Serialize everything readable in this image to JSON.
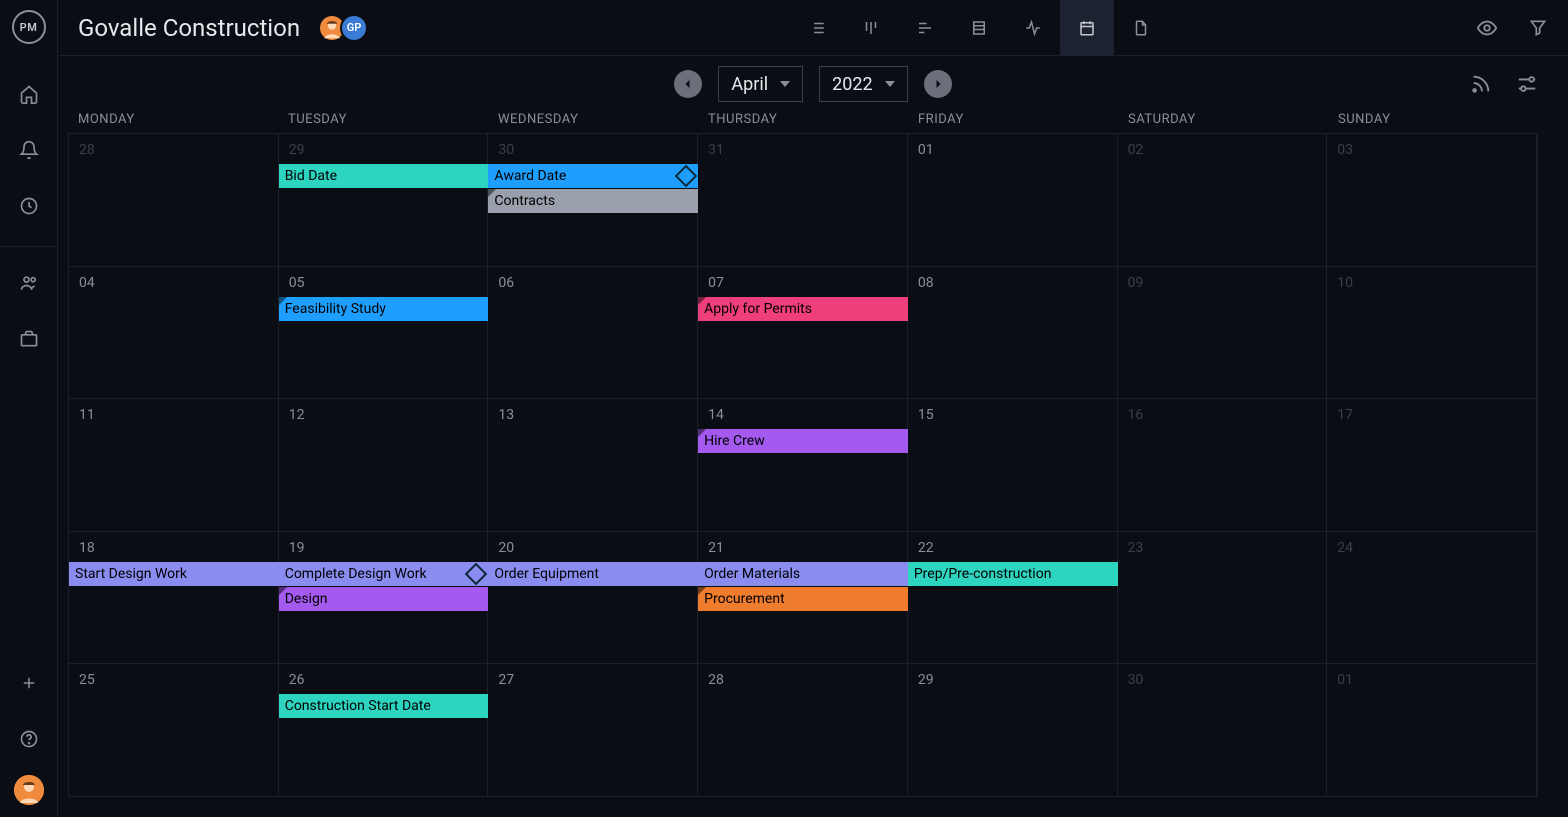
{
  "project": {
    "title": "Govalle Construction"
  },
  "members": [
    {
      "initials": "",
      "bg": "#f08a3c",
      "avatar": true
    },
    {
      "initials": "GP",
      "bg": "#3a7bd5",
      "avatar": false
    }
  ],
  "calendar": {
    "month": "April",
    "year": "2022",
    "dow": [
      "MONDAY",
      "TUESDAY",
      "WEDNESDAY",
      "THURSDAY",
      "FRIDAY",
      "SATURDAY",
      "SUNDAY"
    ],
    "weeks": [
      {
        "days": [
          {
            "n": "28",
            "off": true
          },
          {
            "n": "29",
            "off": true
          },
          {
            "n": "30",
            "off": true
          },
          {
            "n": "31",
            "off": true
          },
          {
            "n": "01",
            "off": false
          },
          {
            "n": "02",
            "off": true
          },
          {
            "n": "03",
            "off": true
          }
        ],
        "events": [
          {
            "label": "Bid Date",
            "startCol": 1,
            "span": 1,
            "row": 0,
            "color": "#2dd4bf",
            "light": false,
            "fold": false,
            "diamond": false
          },
          {
            "label": "Award Date",
            "startCol": 2,
            "span": 1,
            "row": 0,
            "color": "#1e9fff",
            "light": false,
            "fold": false,
            "diamond": true
          },
          {
            "label": "Contracts",
            "startCol": 2,
            "span": 1,
            "row": 1,
            "color": "#9aa0ab",
            "light": false,
            "fold": true,
            "diamond": false
          }
        ]
      },
      {
        "days": [
          {
            "n": "04",
            "off": false
          },
          {
            "n": "05",
            "off": false
          },
          {
            "n": "06",
            "off": false
          },
          {
            "n": "07",
            "off": false
          },
          {
            "n": "08",
            "off": false
          },
          {
            "n": "09",
            "off": true
          },
          {
            "n": "10",
            "off": true
          }
        ],
        "events": [
          {
            "label": "Feasibility Study",
            "startCol": 1,
            "span": 1,
            "row": 0,
            "color": "#1e9fff",
            "light": false,
            "fold": true,
            "diamond": false
          },
          {
            "label": "Apply for Permits",
            "startCol": 3,
            "span": 1,
            "row": 0,
            "color": "#ef3e7c",
            "light": false,
            "fold": true,
            "diamond": false
          }
        ]
      },
      {
        "days": [
          {
            "n": "11",
            "off": false
          },
          {
            "n": "12",
            "off": false
          },
          {
            "n": "13",
            "off": false
          },
          {
            "n": "14",
            "off": false
          },
          {
            "n": "15",
            "off": false
          },
          {
            "n": "16",
            "off": true
          },
          {
            "n": "17",
            "off": true
          }
        ],
        "events": [
          {
            "label": "Hire Crew",
            "startCol": 3,
            "span": 1,
            "row": 0,
            "color": "#a459ef",
            "light": false,
            "fold": true,
            "diamond": false
          }
        ]
      },
      {
        "days": [
          {
            "n": "18",
            "off": false
          },
          {
            "n": "19",
            "off": false
          },
          {
            "n": "20",
            "off": false
          },
          {
            "n": "21",
            "off": false
          },
          {
            "n": "22",
            "off": false
          },
          {
            "n": "23",
            "off": true
          },
          {
            "n": "24",
            "off": true
          }
        ],
        "events": [
          {
            "label": "Start Design Work",
            "startCol": 0,
            "span": 1,
            "row": 0,
            "color": "#8b8cf0",
            "light": false,
            "fold": false,
            "diamond": false
          },
          {
            "label": "Complete Design Work",
            "startCol": 1,
            "span": 1,
            "row": 0,
            "color": "#8b8cf0",
            "light": false,
            "fold": false,
            "diamond": true
          },
          {
            "label": "Order Equipment",
            "startCol": 2,
            "span": 1,
            "row": 0,
            "color": "#8b8cf0",
            "light": false,
            "fold": false,
            "diamond": false
          },
          {
            "label": "Order Materials",
            "startCol": 3,
            "span": 1,
            "row": 0,
            "color": "#8b8cf0",
            "light": false,
            "fold": false,
            "diamond": false
          },
          {
            "label": "Prep/Pre-construction",
            "startCol": 4,
            "span": 1,
            "row": 0,
            "color": "#2dd4bf",
            "light": false,
            "fold": false,
            "diamond": false
          },
          {
            "label": "Design",
            "startCol": 1,
            "span": 1,
            "row": 1,
            "color": "#a459ef",
            "light": false,
            "fold": true,
            "diamond": false
          },
          {
            "label": "Procurement",
            "startCol": 3,
            "span": 1,
            "row": 1,
            "color": "#f07d2e",
            "light": false,
            "fold": true,
            "diamond": false
          }
        ]
      },
      {
        "days": [
          {
            "n": "25",
            "off": false
          },
          {
            "n": "26",
            "off": false
          },
          {
            "n": "27",
            "off": false
          },
          {
            "n": "28",
            "off": false
          },
          {
            "n": "29",
            "off": false
          },
          {
            "n": "30",
            "off": true
          },
          {
            "n": "01",
            "off": true
          }
        ],
        "events": [
          {
            "label": "Construction Start Date",
            "startCol": 1,
            "span": 1,
            "row": 0,
            "color": "#2dd4bf",
            "light": false,
            "fold": false,
            "diamond": false
          }
        ]
      }
    ]
  },
  "colors": {
    "teal": "#2dd4bf",
    "blue": "#1e9fff",
    "grey": "#9aa0ab",
    "pink": "#ef3e7c",
    "purple": "#a459ef",
    "periwinkle": "#8b8cf0",
    "orange": "#f07d2e"
  }
}
